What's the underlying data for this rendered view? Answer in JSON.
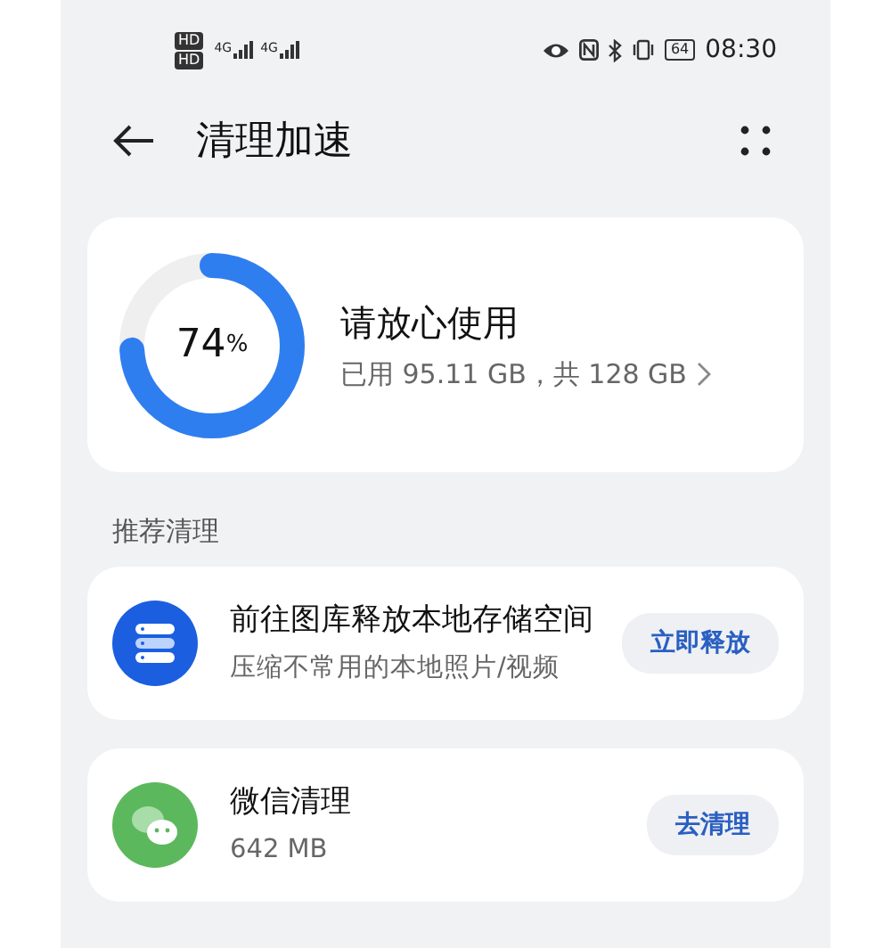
{
  "status_bar": {
    "sim_labels": [
      "HD",
      "HD"
    ],
    "network_labels": [
      "4G",
      "4G"
    ],
    "battery": "64",
    "time": "08:30"
  },
  "header": {
    "title": "清理加速"
  },
  "storage": {
    "percent": "74",
    "unit": "%",
    "level": 0.74,
    "title": "请放心使用",
    "detail": "已用 95.11 GB，共 128 GB"
  },
  "section_label": "推荐清理",
  "items": [
    {
      "title": "前往图库释放本地存储空间",
      "subtitle": "压缩不常用的本地照片/视频",
      "action": "立即释放"
    },
    {
      "title": "微信清理",
      "subtitle": "642 MB",
      "action": "去清理"
    }
  ]
}
